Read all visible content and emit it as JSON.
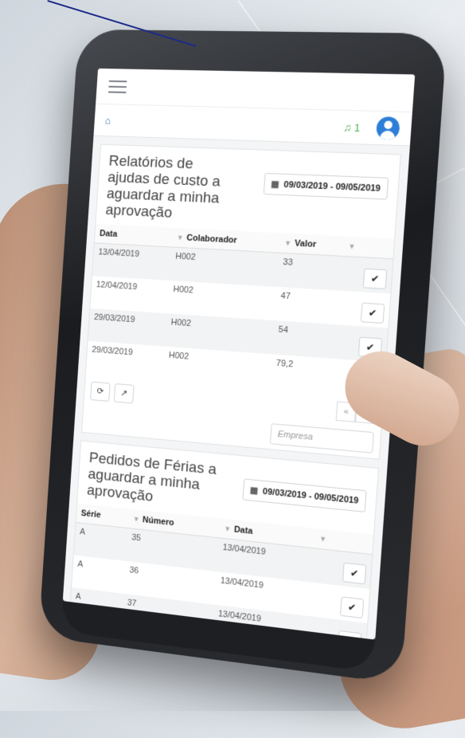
{
  "nav": {
    "notification_count": "1"
  },
  "panel1": {
    "title": "Relatórios de ajudas de custo a aguardar a minha aprovação",
    "daterange": "09/03/2019 - 09/05/2019",
    "columns": {
      "data": "Data",
      "colaborador": "Colaborador",
      "valor": "Valor"
    },
    "rows": [
      {
        "data": "13/04/2019",
        "colaborador": "H002",
        "valor": "33"
      },
      {
        "data": "12/04/2019",
        "colaborador": "H002",
        "valor": "47"
      },
      {
        "data": "29/03/2019",
        "colaborador": "H002",
        "valor": "54"
      },
      {
        "data": "29/03/2019",
        "colaborador": "H002",
        "valor": "79,2"
      }
    ],
    "pager_first": "«"
  },
  "filter": {
    "empresa_placeholder": "Empresa"
  },
  "panel2": {
    "title": "Pedidos de Férias a aguardar a minha aprovação",
    "daterange": "09/03/2019 - 09/05/2019",
    "columns": {
      "serie": "Série",
      "numero": "Número",
      "data": "Data"
    },
    "rows": [
      {
        "serie": "A",
        "numero": "35",
        "data": "13/04/2019"
      },
      {
        "serie": "A",
        "numero": "36",
        "data": "13/04/2019"
      },
      {
        "serie": "A",
        "numero": "37",
        "data": "13/04/2019"
      }
    ]
  },
  "colors": {
    "accent": "#2d7ed6",
    "bell": "#4caf50"
  },
  "icons": [
    "menu-icon",
    "home-icon",
    "bell-icon",
    "user-avatar-icon",
    "calendar-icon",
    "filter-icon",
    "checkmark-icon",
    "refresh-icon",
    "external-link-icon"
  ]
}
